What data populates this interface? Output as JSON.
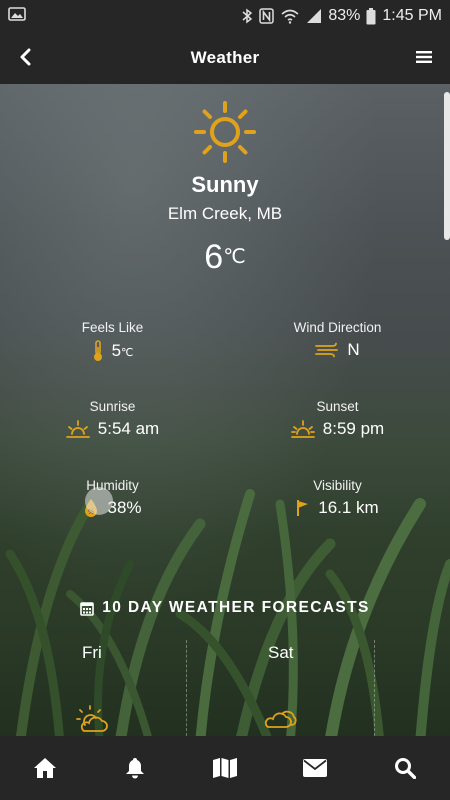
{
  "status_bar": {
    "battery": "83%",
    "time": "1:45 PM",
    "icons": [
      "image-icon",
      "bluetooth-icon",
      "nfc-icon",
      "wifi-icon",
      "signal-icon",
      "battery-icon"
    ]
  },
  "header": {
    "title": "Weather",
    "back_icon": "chevron-left-icon",
    "menu_icon": "hamburger-menu-icon"
  },
  "current": {
    "icon": "sun-icon",
    "condition": "Sunny",
    "location": "Elm Creek, MB",
    "temp": "6",
    "temp_unit": "℃"
  },
  "stats": {
    "feels_like": {
      "label": "Feels Like",
      "value": "5",
      "unit": "℃",
      "icon": "thermometer-icon"
    },
    "wind_direction": {
      "label": "Wind Direction",
      "value": "N",
      "icon": "wind-icon"
    },
    "sunrise": {
      "label": "Sunrise",
      "value": "5:54 am",
      "icon": "sunrise-icon"
    },
    "sunset": {
      "label": "Sunset",
      "value": "8:59 pm",
      "icon": "sunset-icon"
    },
    "humidity": {
      "label": "Humidity",
      "value": "38%",
      "icon": "humidity-icon"
    },
    "visibility": {
      "label": "Visibility",
      "value": "16.1 km",
      "icon": "flag-icon"
    }
  },
  "forecast": {
    "title": "10 DAY WEATHER FORECASTS",
    "icon": "calendar-icon",
    "days": [
      {
        "name": "Fri",
        "icon": "partly-cloudy-icon"
      },
      {
        "name": "Sat",
        "icon": "cloudy-icon"
      }
    ]
  },
  "bottom_nav": [
    "home-icon",
    "bell-icon",
    "map-icon",
    "mail-icon",
    "search-icon"
  ],
  "colors": {
    "accent": "#e0a21b",
    "bar_bg": "#262626"
  }
}
